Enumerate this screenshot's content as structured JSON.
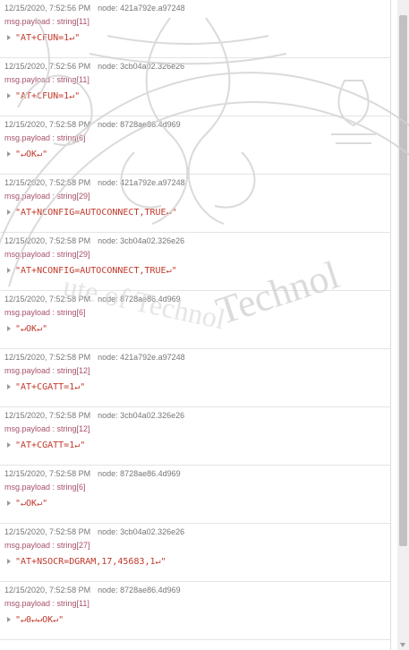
{
  "debug_panel": {
    "messages": [
      {
        "timestamp": "12/15/2020, 7:52:56 PM",
        "node": "node: 421a792e.a97248",
        "topic": "msg.payload : string[11]",
        "value": "\"AT+CFUN=1↵\""
      },
      {
        "timestamp": "12/15/2020, 7:52:56 PM",
        "node": "node: 3cb04a02.326e26",
        "topic": "msg.payload : string[11]",
        "value": "\"AT+CFUN=1↵\""
      },
      {
        "timestamp": "12/15/2020, 7:52:58 PM",
        "node": "node: 8728ae86.4d969",
        "topic": "msg.payload : string[6]",
        "value": "\"↵OK↵\""
      },
      {
        "timestamp": "12/15/2020, 7:52:58 PM",
        "node": "node: 421a792e.a97248",
        "topic": "msg.payload : string[29]",
        "value": "\"AT+NCONFIG=AUTOCONNECT,TRUE↵\""
      },
      {
        "timestamp": "12/15/2020, 7:52:58 PM",
        "node": "node: 3cb04a02.326e26",
        "topic": "msg.payload : string[29]",
        "value": "\"AT+NCONFIG=AUTOCONNECT,TRUE↵\""
      },
      {
        "timestamp": "12/15/2020, 7:52:58 PM",
        "node": "node: 8728ae86.4d969",
        "topic": "msg.payload : string[6]",
        "value": "\"↵OK↵\""
      },
      {
        "timestamp": "12/15/2020, 7:52:58 PM",
        "node": "node: 421a792e.a97248",
        "topic": "msg.payload : string[12]",
        "value": "\"AT+CGATT=1↵\""
      },
      {
        "timestamp": "12/15/2020, 7:52:58 PM",
        "node": "node: 3cb04a02.326e26",
        "topic": "msg.payload : string[12]",
        "value": "\"AT+CGATT=1↵\""
      },
      {
        "timestamp": "12/15/2020, 7:52:58 PM",
        "node": "node: 8728ae86.4d969",
        "topic": "msg.payload : string[6]",
        "value": "\"↵OK↵\""
      },
      {
        "timestamp": "12/15/2020, 7:52:58 PM",
        "node": "node: 3cb04a02.326e26",
        "topic": "msg.payload : string[27]",
        "value": "\"AT+NSOCR=DGRAM,17,45683,1↵\""
      },
      {
        "timestamp": "12/15/2020, 7:52:58 PM",
        "node": "node: 8728ae86.4d969",
        "topic": "msg.payload : string[11]",
        "value": "\"↵0↵↵OK↵\""
      }
    ]
  },
  "scrollbar": {
    "position": 0.12,
    "visible_fraction": 0.83
  },
  "watermark": {
    "text": "Technol",
    "text_left": "ute of Technol",
    "color": "#cfcfcf"
  },
  "colors": {
    "timestamp": "#777777",
    "topic": "#a8526a",
    "payload_string": "#c0392b",
    "row_divider": "#e4e4e4"
  }
}
